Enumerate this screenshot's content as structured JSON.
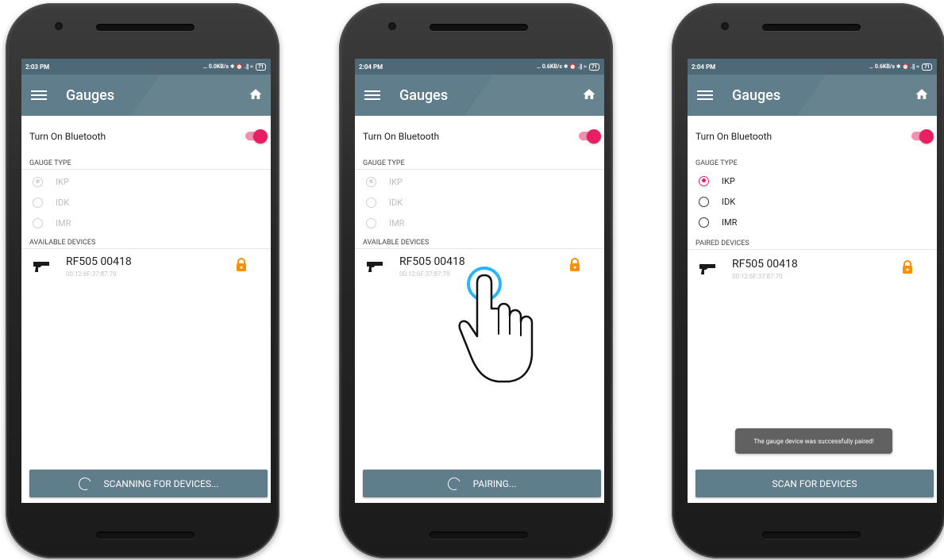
{
  "screens": [
    {
      "status_time": "2:03 PM",
      "status_info": "… 0.0KB/s ✱ ⏰ .∥ ≈",
      "battery": "71",
      "title": "Gauges",
      "bluetooth_label": "Turn On Bluetooth",
      "gauge_type_header": "GAUGE TYPE",
      "gauge_types": [
        "IKP",
        "IDK",
        "IMR"
      ],
      "devices_header": "AVAILABLE DEVICES",
      "device_name": "RF505 00418",
      "device_mac": "00:12:6F:37:87:70",
      "button_label": "SCANNING FOR DEVICES..."
    },
    {
      "status_time": "2:04 PM",
      "status_info": "… 0.6KB/s ✱ ⏰ .∥ ≈",
      "battery": "71",
      "title": "Gauges",
      "bluetooth_label": "Turn On Bluetooth",
      "gauge_type_header": "GAUGE TYPE",
      "gauge_types": [
        "IKP",
        "IDK",
        "IMR"
      ],
      "devices_header": "AVAILABLE DEVICES",
      "device_name": "RF505 00418",
      "device_mac": "00:12:6F:37:87:70",
      "button_label": "PAIRING..."
    },
    {
      "status_time": "2:04 PM",
      "status_info": "… 0.6KB/s ✱ ⏰ .∥ ≈",
      "battery": "71",
      "title": "Gauges",
      "bluetooth_label": "Turn On Bluetooth",
      "gauge_type_header": "GAUGE TYPE",
      "gauge_types": [
        "IKP",
        "IDK",
        "IMR"
      ],
      "devices_header": "PAIRED DEVICES",
      "device_name": "RF505 00418",
      "device_mac": "00:12:6F:37:87:70",
      "button_label": "SCAN FOR DEVICES",
      "toast": "The gauge device was successfully paired!"
    }
  ],
  "colors": {
    "appbar": "#607d8b",
    "statusbar": "#4e6877",
    "accent": "#e91e63",
    "lock": "#ff8f00"
  },
  "icons": [
    "menu-icon",
    "home-icon",
    "gauge-gun-icon",
    "lock-icon",
    "spinner-icon",
    "tap-hand-icon"
  ]
}
